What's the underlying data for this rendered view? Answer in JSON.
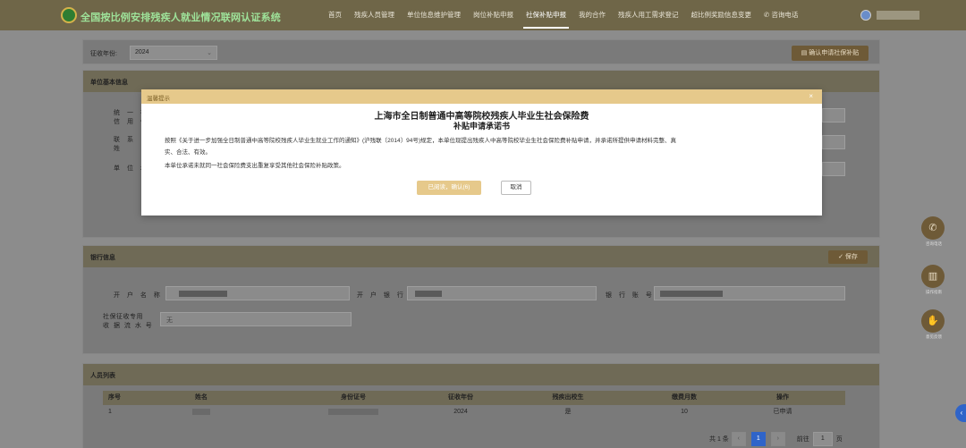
{
  "app": {
    "title": "全国按比例安排残疾人就业情况联网认证系统"
  },
  "nav": {
    "items": [
      "首页",
      "残疾人员管理",
      "单位信息维护管理",
      "岗位补贴申报",
      "社保补贴申报",
      "我的合作",
      "残疾人用工需求登记",
      "超比例奖励信息变更",
      "咨询电话"
    ],
    "active_index": 4
  },
  "filter": {
    "label": "征收年份:",
    "year": "2024",
    "confirm_label": "确认申请社保补贴"
  },
  "unit_panel": {
    "title": "单位基本信息",
    "row1": "统 一 社 会",
    "row1b": "信 用 代",
    "row2": "联 系",
    "row2b": "姓",
    "row3": "单 位 地"
  },
  "bank_panel": {
    "title": "银行信息",
    "save_label": "保存",
    "account_name_label": "开 户 名 称",
    "bank_label": "开 户 银 行",
    "account_no_label": "银 行 账 号",
    "serial_label_1": "社保征收专用",
    "serial_label_2": "收 据 流 水 号",
    "serial_value": "无"
  },
  "people_panel": {
    "title": "人员列表",
    "headers": [
      "序号",
      "姓名",
      "身份证号",
      "征收年份",
      "残疾出校生",
      "缴费月数",
      "操作"
    ],
    "rows": [
      {
        "index": "1",
        "year": "2024",
        "graduate": "是",
        "months": "10",
        "action": "已申请"
      }
    ],
    "pager": {
      "total": "共 1 条",
      "prev": "‹",
      "current": "1",
      "next": "›",
      "goto": "前往",
      "page_input": "1",
      "page_unit": "页"
    }
  },
  "float": {
    "phone_label": "咨询电话",
    "guide_label": "操作指南",
    "feedback_label": "意见反馈",
    "tab_label": "‹"
  },
  "modal": {
    "header": "温馨提示",
    "close": "×",
    "title_line1": "上海市全日制普通中高等院校残疾人毕业生社会保险费",
    "title_line2": "补贴申请承诺书",
    "para1": "按照《关于进一步加强全日制普通中高等院校残疾人毕业生就业工作的通知》(沪残联〔2014〕94号)规定，本单位现提出残疾人中高等院校毕业生社会保险费补贴申请，并承诺所提供申请材料完整、真",
    "para1b": "实、合法、有效。",
    "para2": "本单位承诺未就同一社会保险费支出重复享受其他社会保险补贴政策。",
    "agree_label": "已阅读，确认(6)",
    "cancel_label": "取消"
  }
}
